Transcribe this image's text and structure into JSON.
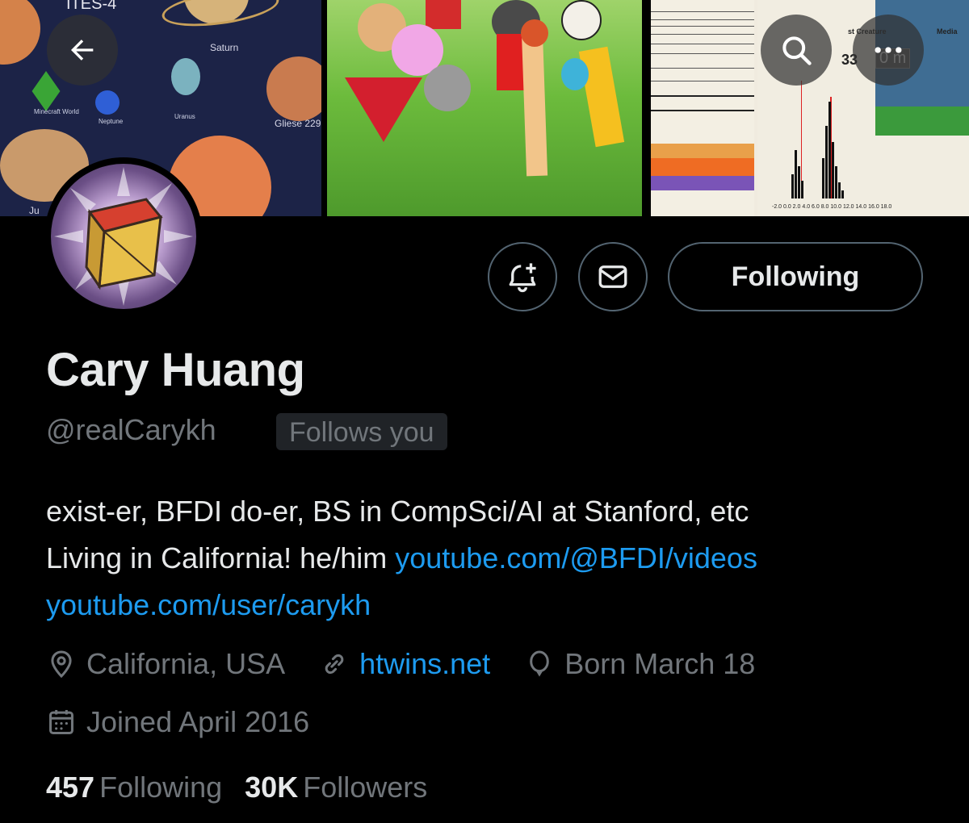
{
  "header": {
    "back_icon": "arrow-left-icon",
    "search_icon": "search-icon",
    "more_icon": "more-horizontal-icon"
  },
  "banner": {
    "panel1_labels": [
      "ITES-4",
      "Saturn",
      "Minecraft World",
      "Neptune",
      "Uranus",
      "Gliese 229",
      "Ju"
    ],
    "panel3_labels": [
      "st Creature",
      "Media",
      "33",
      "0 m"
    ],
    "panel3_axis": "-2.0  0.0  2.0  4.0  6.0  8.0  10.0  12.0  14.0  16.0  18.0"
  },
  "actions": {
    "notify_icon": "bell-plus-icon",
    "message_icon": "mail-icon",
    "following_label": "Following"
  },
  "profile": {
    "name": "Cary Huang",
    "handle": "@realCarykh",
    "follows_you": "Follows you",
    "bio_line1": "exist-er, BFDI do-er, BS in CompSci/AI at Stanford, etc",
    "bio_line2_text": "Living in California! he/him ",
    "bio_link1": "youtube.com/@BFDI/videos",
    "bio_link2": "youtube.com/user/carykh",
    "location": "California, USA",
    "website": "htwins.net",
    "birthday": "Born March 18",
    "joined": "Joined April 2016"
  },
  "stats": {
    "following_count": "457",
    "following_label": "Following",
    "followers_count": "30K",
    "followers_label": "Followers"
  },
  "colors": {
    "background": "#000000",
    "text": "#e7e9ea",
    "muted": "#71767b",
    "link": "#1d9bf0",
    "border": "#536471"
  }
}
